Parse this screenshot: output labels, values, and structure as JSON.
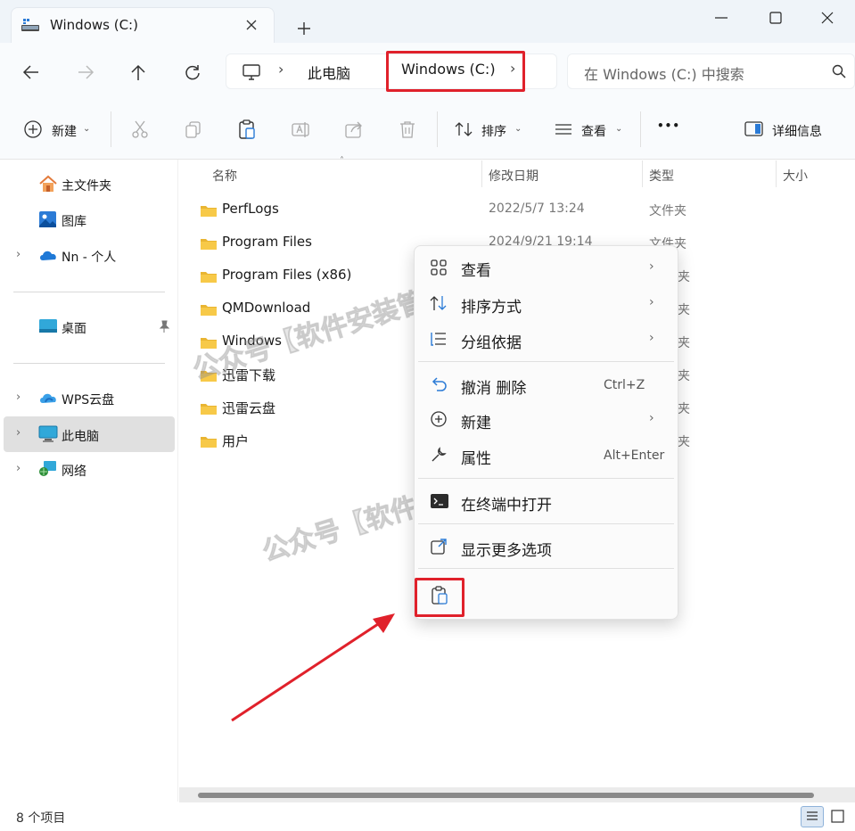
{
  "tab": {
    "title": "Windows (C:)",
    "close": "✕",
    "new": "+"
  },
  "window": {
    "min": "—",
    "close": "✕"
  },
  "address": {
    "sep1": "›",
    "crumb1": "此电脑",
    "crumb2": "Windows (C:)",
    "sep2": "›"
  },
  "search": {
    "placeholder": "在 Windows (C:) 中搜索"
  },
  "toolbar": {
    "new": "新建",
    "sort": "排序",
    "view": "查看",
    "more": "•••",
    "details": "详细信息"
  },
  "sidebar": {
    "items": [
      {
        "label": "主文件夹"
      },
      {
        "label": "图库"
      },
      {
        "label": "Nn - 个人"
      },
      {
        "label": "桌面"
      },
      {
        "label": "WPS云盘"
      },
      {
        "label": "此电脑"
      },
      {
        "label": "网络"
      }
    ]
  },
  "columns": {
    "name": "名称",
    "date": "修改日期",
    "type": "类型",
    "size": "大小"
  },
  "rows": [
    {
      "name": "PerfLogs",
      "date": "2022/5/7 13:24",
      "type": "文件夹"
    },
    {
      "name": "Program Files",
      "date": "2024/9/21 19:14",
      "type": "文件夹"
    },
    {
      "name": "Program Files (x86)",
      "type": "夹"
    },
    {
      "name": "QMDownload",
      "type": "夹"
    },
    {
      "name": "Windows",
      "type": "夹"
    },
    {
      "name": "迅雷下载",
      "type": "夹"
    },
    {
      "name": "迅雷云盘",
      "type": "夹"
    },
    {
      "name": "用户",
      "type": "夹"
    }
  ],
  "menu": {
    "view": "查看",
    "sort": "排序方式",
    "group": "分组依据",
    "undo": "撤消 删除",
    "undo_shortcut": "Ctrl+Z",
    "new": "新建",
    "props": "属性",
    "props_shortcut": "Alt+Enter",
    "terminal": "在终端中打开",
    "more": "显示更多选项"
  },
  "watermark": "公众号【软件安装管家目录】",
  "status": {
    "count": "8 个项目"
  }
}
